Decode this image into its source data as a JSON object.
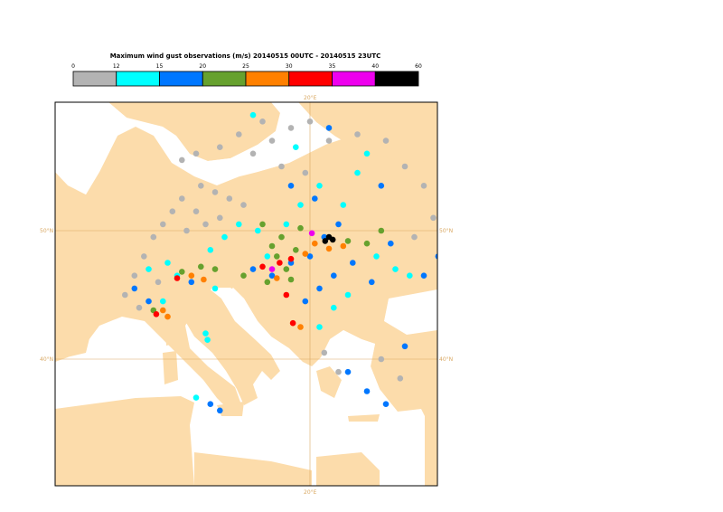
{
  "title": "Maximum wind gust observations (m/s) 20140515 00UTC - 20140515 23UTC",
  "legend": {
    "ticks": [
      "0",
      "12",
      "15",
      "20",
      "25",
      "30",
      "35",
      "40",
      "60"
    ],
    "bins": [
      {
        "range": "0-12",
        "color": "#b3b3b3"
      },
      {
        "range": "12-15",
        "color": "#00ffff"
      },
      {
        "range": "15-20",
        "color": "#0077ff"
      },
      {
        "range": "20-25",
        "color": "#66a12e"
      },
      {
        "range": "25-30",
        "color": "#ff8000"
      },
      {
        "range": "30-35",
        "color": "#ff0000"
      },
      {
        "range": "35-40",
        "color": "#ee00ee"
      },
      {
        "range": "40-60",
        "color": "#000000"
      }
    ]
  },
  "map": {
    "land_color": "#fcdcab",
    "sea_color": "#ffffff",
    "grid_color": "#d9a862",
    "grid_labels": {
      "lon_top": "20°E",
      "lon_bottom": "20°E",
      "lat_50_left": "50°N",
      "lat_50_right": "50°N",
      "lat_40_left": "40°N",
      "lat_40_right": "40°N"
    }
  },
  "stations": [
    {
      "lon": 10.5,
      "lat": 51.0,
      "cat": 0
    },
    {
      "lon": 9.0,
      "lat": 50.5,
      "cat": 0
    },
    {
      "lon": 8.0,
      "lat": 51.5,
      "cat": 0
    },
    {
      "lon": 7.0,
      "lat": 50.0,
      "cat": 0
    },
    {
      "lon": 6.5,
      "lat": 52.5,
      "cat": 0
    },
    {
      "lon": 5.5,
      "lat": 51.5,
      "cat": 0
    },
    {
      "lon": 4.5,
      "lat": 50.5,
      "cat": 0
    },
    {
      "lon": 8.5,
      "lat": 53.5,
      "cat": 0
    },
    {
      "lon": 10.0,
      "lat": 53.0,
      "cat": 0
    },
    {
      "lon": 11.5,
      "lat": 52.5,
      "cat": 0
    },
    {
      "lon": 13.0,
      "lat": 52.0,
      "cat": 0
    },
    {
      "lon": 3.5,
      "lat": 49.5,
      "cat": 0
    },
    {
      "lon": 2.5,
      "lat": 48.0,
      "cat": 0
    },
    {
      "lon": 1.5,
      "lat": 46.5,
      "cat": 0
    },
    {
      "lon": 0.5,
      "lat": 45.0,
      "cat": 0
    },
    {
      "lon": 2.0,
      "lat": 44.0,
      "cat": 0
    },
    {
      "lon": 4.0,
      "lat": 46.0,
      "cat": 0
    },
    {
      "lon": 6.5,
      "lat": 55.5,
      "cat": 0
    },
    {
      "lon": 8.0,
      "lat": 56.0,
      "cat": 0
    },
    {
      "lon": 10.5,
      "lat": 56.5,
      "cat": 0
    },
    {
      "lon": 12.5,
      "lat": 57.5,
      "cat": 0
    },
    {
      "lon": 14.0,
      "lat": 56.0,
      "cat": 0
    },
    {
      "lon": 16.0,
      "lat": 57.0,
      "cat": 0
    },
    {
      "lon": 18.0,
      "lat": 58.0,
      "cat": 0
    },
    {
      "lon": 20.0,
      "lat": 58.5,
      "cat": 0
    },
    {
      "lon": 15.0,
      "lat": 58.5,
      "cat": 0
    },
    {
      "lon": 22.0,
      "lat": 57.0,
      "cat": 0
    },
    {
      "lon": 25.0,
      "lat": 57.5,
      "cat": 0
    },
    {
      "lon": 28.0,
      "lat": 57.0,
      "cat": 0
    },
    {
      "lon": 30.0,
      "lat": 55.0,
      "cat": 0
    },
    {
      "lon": 32.0,
      "lat": 53.5,
      "cat": 0
    },
    {
      "lon": 33.0,
      "lat": 51.0,
      "cat": 0
    },
    {
      "lon": 31.0,
      "lat": 49.5,
      "cat": 0
    },
    {
      "lon": 21.5,
      "lat": 40.5,
      "cat": 0
    },
    {
      "lon": 23.0,
      "lat": 39.0,
      "cat": 0
    },
    {
      "lon": 27.5,
      "lat": 40.0,
      "cat": 0
    },
    {
      "lon": 29.5,
      "lat": 38.5,
      "cat": 0
    },
    {
      "lon": 19.5,
      "lat": 54.5,
      "cat": 0
    },
    {
      "lon": 17.0,
      "lat": 55.0,
      "cat": 0
    },
    {
      "lon": 3.0,
      "lat": 47.0,
      "cat": 1
    },
    {
      "lon": 5.0,
      "lat": 47.5,
      "cat": 1
    },
    {
      "lon": 6.0,
      "lat": 46.5,
      "cat": 1
    },
    {
      "lon": 9.5,
      "lat": 48.5,
      "cat": 1
    },
    {
      "lon": 11.0,
      "lat": 49.5,
      "cat": 1
    },
    {
      "lon": 12.5,
      "lat": 50.5,
      "cat": 1
    },
    {
      "lon": 14.5,
      "lat": 50.0,
      "cat": 1
    },
    {
      "lon": 15.5,
      "lat": 48.0,
      "cat": 1
    },
    {
      "lon": 17.5,
      "lat": 50.5,
      "cat": 1
    },
    {
      "lon": 19.0,
      "lat": 52.0,
      "cat": 1
    },
    {
      "lon": 21.0,
      "lat": 53.5,
      "cat": 1
    },
    {
      "lon": 23.5,
      "lat": 52.0,
      "cat": 1
    },
    {
      "lon": 25.0,
      "lat": 54.5,
      "cat": 1
    },
    {
      "lon": 27.0,
      "lat": 48.0,
      "cat": 1
    },
    {
      "lon": 29.0,
      "lat": 47.0,
      "cat": 1
    },
    {
      "lon": 22.5,
      "lat": 44.0,
      "cat": 1
    },
    {
      "lon": 21.0,
      "lat": 42.5,
      "cat": 1
    },
    {
      "lon": 9.0,
      "lat": 42.0,
      "cat": 1
    },
    {
      "lon": 9.2,
      "lat": 41.5,
      "cat": 1
    },
    {
      "lon": 8.0,
      "lat": 37.0,
      "cat": 1
    },
    {
      "lon": 4.5,
      "lat": 44.5,
      "cat": 1
    },
    {
      "lon": 14.0,
      "lat": 59.0,
      "cat": 1
    },
    {
      "lon": 18.5,
      "lat": 56.5,
      "cat": 1
    },
    {
      "lon": 26.0,
      "lat": 56.0,
      "cat": 1
    },
    {
      "lon": 30.5,
      "lat": 46.5,
      "cat": 1
    },
    {
      "lon": 24.0,
      "lat": 45.0,
      "cat": 1
    },
    {
      "lon": 10.0,
      "lat": 45.5,
      "cat": 1
    },
    {
      "lon": 14.0,
      "lat": 47.0,
      "cat": 2
    },
    {
      "lon": 16.0,
      "lat": 46.5,
      "cat": 2
    },
    {
      "lon": 18.0,
      "lat": 47.5,
      "cat": 2
    },
    {
      "lon": 20.0,
      "lat": 48.0,
      "cat": 2
    },
    {
      "lon": 21.5,
      "lat": 49.5,
      "cat": 2
    },
    {
      "lon": 23.0,
      "lat": 50.5,
      "cat": 2
    },
    {
      "lon": 20.5,
      "lat": 52.5,
      "cat": 2
    },
    {
      "lon": 18.0,
      "lat": 53.5,
      "cat": 2
    },
    {
      "lon": 24.5,
      "lat": 47.5,
      "cat": 2
    },
    {
      "lon": 26.5,
      "lat": 46.0,
      "cat": 2
    },
    {
      "lon": 28.5,
      "lat": 49.0,
      "cat": 2
    },
    {
      "lon": 32.0,
      "lat": 46.5,
      "cat": 2
    },
    {
      "lon": 21.0,
      "lat": 45.5,
      "cat": 2
    },
    {
      "lon": 22.5,
      "lat": 46.5,
      "cat": 2
    },
    {
      "lon": 19.5,
      "lat": 44.5,
      "cat": 2
    },
    {
      "lon": 24.0,
      "lat": 39.0,
      "cat": 2
    },
    {
      "lon": 26.0,
      "lat": 37.5,
      "cat": 2
    },
    {
      "lon": 28.0,
      "lat": 36.5,
      "cat": 2
    },
    {
      "lon": 30.0,
      "lat": 41.0,
      "cat": 2
    },
    {
      "lon": 9.5,
      "lat": 36.5,
      "cat": 2
    },
    {
      "lon": 10.5,
      "lat": 36.0,
      "cat": 2
    },
    {
      "lon": 1.5,
      "lat": 45.5,
      "cat": 2
    },
    {
      "lon": 3.0,
      "lat": 44.5,
      "cat": 2
    },
    {
      "lon": 7.5,
      "lat": 46.0,
      "cat": 2
    },
    {
      "lon": 22.0,
      "lat": 58.0,
      "cat": 2
    },
    {
      "lon": 27.5,
      "lat": 53.5,
      "cat": 2
    },
    {
      "lon": 33.5,
      "lat": 48.0,
      "cat": 2
    },
    {
      "lon": 16.5,
      "lat": 48.0,
      "cat": 3
    },
    {
      "lon": 17.5,
      "lat": 47.0,
      "cat": 3
    },
    {
      "lon": 18.5,
      "lat": 48.5,
      "cat": 3
    },
    {
      "lon": 17.0,
      "lat": 49.5,
      "cat": 3
    },
    {
      "lon": 16.0,
      "lat": 48.8,
      "cat": 3
    },
    {
      "lon": 18.0,
      "lat": 46.2,
      "cat": 3
    },
    {
      "lon": 15.5,
      "lat": 46.0,
      "cat": 3
    },
    {
      "lon": 13.0,
      "lat": 46.5,
      "cat": 3
    },
    {
      "lon": 10.0,
      "lat": 47.0,
      "cat": 3
    },
    {
      "lon": 8.5,
      "lat": 47.2,
      "cat": 3
    },
    {
      "lon": 6.5,
      "lat": 46.8,
      "cat": 3
    },
    {
      "lon": 3.5,
      "lat": 43.8,
      "cat": 3
    },
    {
      "lon": 26.0,
      "lat": 49.0,
      "cat": 3
    },
    {
      "lon": 27.5,
      "lat": 50.0,
      "cat": 3
    },
    {
      "lon": 24.0,
      "lat": 49.2,
      "cat": 3
    },
    {
      "lon": 19.0,
      "lat": 50.2,
      "cat": 3
    },
    {
      "lon": 15.0,
      "lat": 50.5,
      "cat": 3
    },
    {
      "lon": 20.5,
      "lat": 49.0,
      "cat": 4
    },
    {
      "lon": 22.0,
      "lat": 48.6,
      "cat": 4
    },
    {
      "lon": 23.5,
      "lat": 48.8,
      "cat": 4
    },
    {
      "lon": 19.5,
      "lat": 48.2,
      "cat": 4
    },
    {
      "lon": 7.5,
      "lat": 46.5,
      "cat": 4
    },
    {
      "lon": 8.8,
      "lat": 46.2,
      "cat": 4
    },
    {
      "lon": 4.5,
      "lat": 43.8,
      "cat": 4
    },
    {
      "lon": 5.0,
      "lat": 43.3,
      "cat": 4
    },
    {
      "lon": 19.0,
      "lat": 42.5,
      "cat": 4
    },
    {
      "lon": 16.5,
      "lat": 46.3,
      "cat": 4
    },
    {
      "lon": 15.0,
      "lat": 47.2,
      "cat": 5
    },
    {
      "lon": 16.8,
      "lat": 47.5,
      "cat": 5
    },
    {
      "lon": 18.0,
      "lat": 47.8,
      "cat": 5
    },
    {
      "lon": 6.0,
      "lat": 46.3,
      "cat": 5
    },
    {
      "lon": 3.8,
      "lat": 43.5,
      "cat": 5
    },
    {
      "lon": 18.2,
      "lat": 42.8,
      "cat": 5
    },
    {
      "lon": 17.5,
      "lat": 45.0,
      "cat": 5
    },
    {
      "lon": 20.2,
      "lat": 49.8,
      "cat": 6
    },
    {
      "lon": 16.0,
      "lat": 47.0,
      "cat": 6
    },
    {
      "lon": 22.0,
      "lat": 49.5,
      "cat": 7
    },
    {
      "lon": 22.4,
      "lat": 49.3,
      "cat": 7
    },
    {
      "lon": 21.6,
      "lat": 49.2,
      "cat": 7
    }
  ]
}
